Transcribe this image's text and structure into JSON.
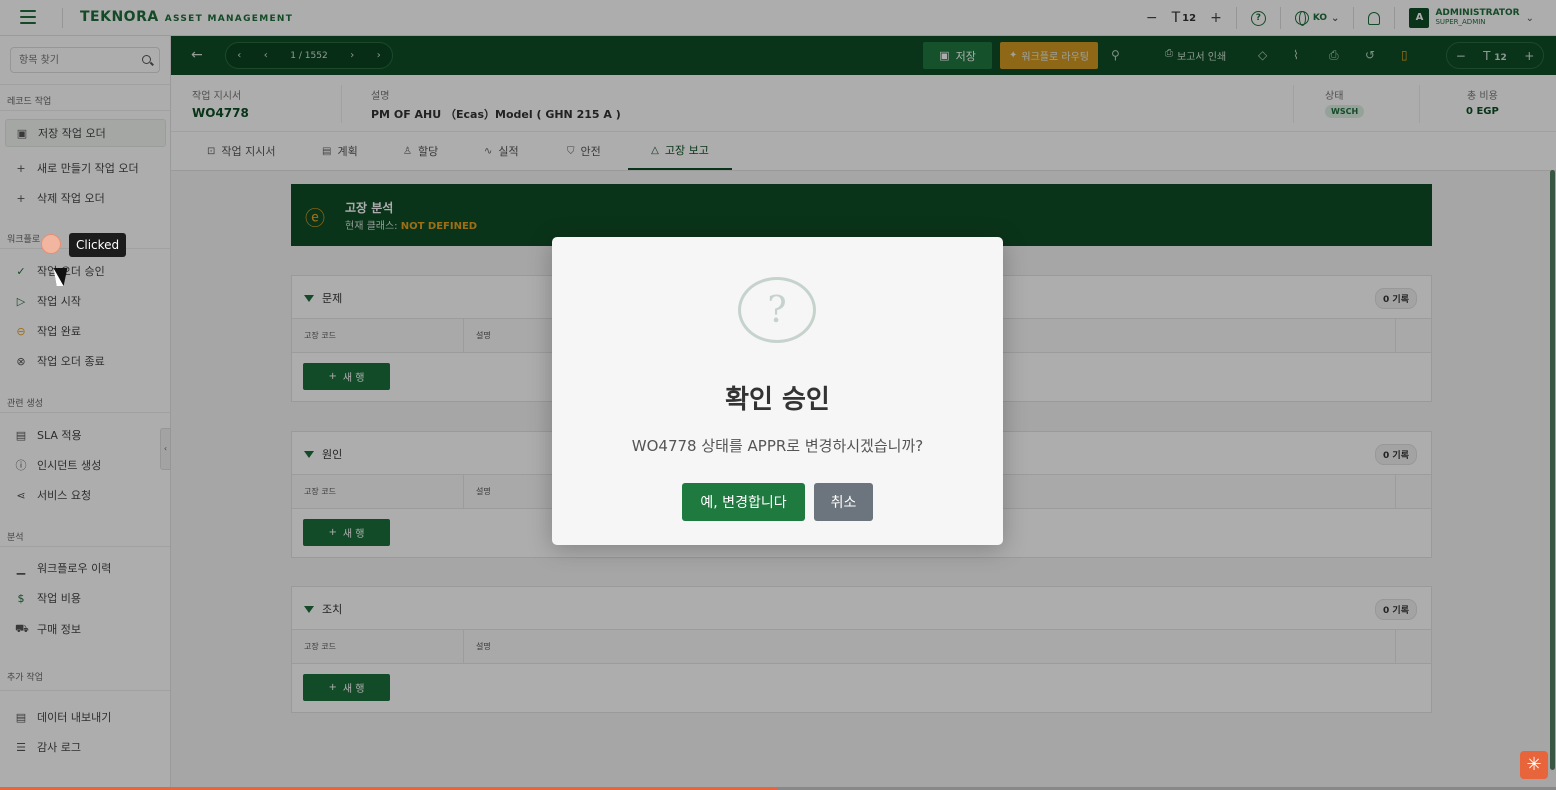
{
  "app": {
    "logo_main": "TEKNORA",
    "logo_sub": "ASSET MANAGEMENT",
    "font_size": "12",
    "lang": "KO",
    "user_name": "ADMINISTRATOR",
    "user_role": "SUPER_ADMIN",
    "avatar_letter": "A"
  },
  "sidebar": {
    "search_placeholder": "항목 찾기",
    "groups": {
      "record": "레코드 작업",
      "workflow": "워크플로",
      "related": "관련 생성",
      "analysis": "분석",
      "extra": "추가 작업"
    },
    "items": {
      "save_wo": "저장 작업 오더",
      "new_wo": "새로 만들기 작업 오더",
      "delete_wo": "삭제 작업 오더",
      "approve_wo": "작업 오더 승인",
      "start_work": "작업 시작",
      "complete_work": "작업 완료",
      "close_wo": "작업 오더 종료",
      "apply_sla": "SLA 적용",
      "create_incident": "인시던트 생성",
      "service_request": "서비스 요청",
      "workflow_history": "워크플로우 이력",
      "work_cost": "작업 비용",
      "purchase_info": "구매 정보",
      "export_data": "데이터 내보내기",
      "audit_log": "감사 로그"
    }
  },
  "clicked_tip": "Clicked",
  "toolbar": {
    "pager": "1 / 1552",
    "save": "저장",
    "workflow_route": "워크플로 라우팅",
    "print_report": "보고서 인쇄",
    "font_size": "12"
  },
  "header": {
    "wo_label": "작업 지시서",
    "wo_value": "WO4778",
    "desc_label": "설명",
    "desc_value": "PM OF AHU （Ecas）Model ( GHN 215 A )",
    "status_label": "상태",
    "status_value": "WSCH",
    "cost_label": "총 비용",
    "cost_value": "0 EGP"
  },
  "tabs": {
    "work_order": "작업 지시서",
    "plan": "계획",
    "assign": "할당",
    "actual": "실적",
    "safety": "안전",
    "failure": "고장 보고"
  },
  "failure_banner": {
    "title": "고장 분석",
    "subtitle_prefix": "현재 클래스:",
    "subtitle_value": "NOT DEFINED"
  },
  "sections": {
    "problem": {
      "title": "문제",
      "records": "0 기록",
      "col1": "고장 코드",
      "col2": "설명",
      "new_row": "새 행"
    },
    "cause": {
      "title": "원인",
      "records": "0 기록",
      "col1": "고장 코드",
      "col2": "설명",
      "new_row": "새 행"
    },
    "remedy": {
      "title": "조치",
      "records": "0 기록",
      "col1": "고장 코드",
      "col2": "설명",
      "new_row": "새 행"
    }
  },
  "modal": {
    "title": "확인 승인",
    "message": "WO4778 상태를 APPR로 변경하시겠습니까?",
    "confirm": "예, 변경합니다",
    "cancel": "취소"
  },
  "colors": {
    "brand_green": "#0f4d27",
    "accent_orange": "#e8a321",
    "button_green": "#1f7a40"
  }
}
